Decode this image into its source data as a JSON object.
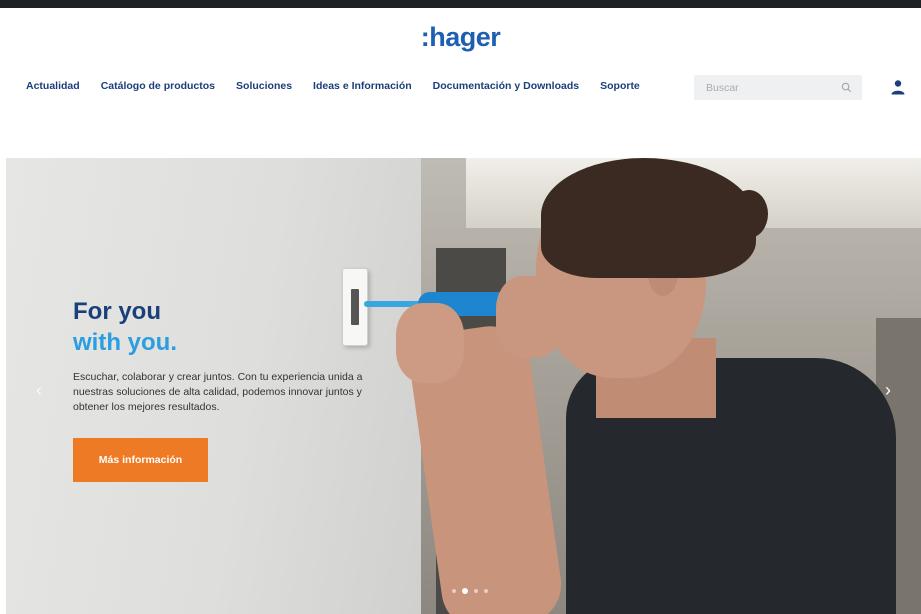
{
  "brand": {
    "logo": ":hager",
    "color": "#1f5fb2"
  },
  "nav": {
    "items": [
      {
        "label": "Actualidad"
      },
      {
        "label": "Catálogo de productos"
      },
      {
        "label": "Soluciones"
      },
      {
        "label": "Ideas e Información"
      },
      {
        "label": "Documentación y Downloads"
      },
      {
        "label": "Soporte"
      }
    ]
  },
  "search": {
    "placeholder": "Buscar",
    "icon": "search-icon"
  },
  "account": {
    "icon": "user-icon"
  },
  "hero": {
    "title_line1": "For you",
    "title_line2": "with you.",
    "text": "Escuchar, colaborar y crear juntos. Con tu experiencia unida a nuestras soluciones de alta calidad, podemos innovar juntos y obtener los mejores resultados.",
    "cta_label": "Más información",
    "prev_icon": "chevron-left-icon",
    "next_icon": "chevron-right-icon",
    "slides_count": 4,
    "active_slide": 2,
    "colors": {
      "title_dark": "#1a3f7a",
      "title_accent": "#2a9ee0",
      "cta": "#ef7a25"
    }
  }
}
